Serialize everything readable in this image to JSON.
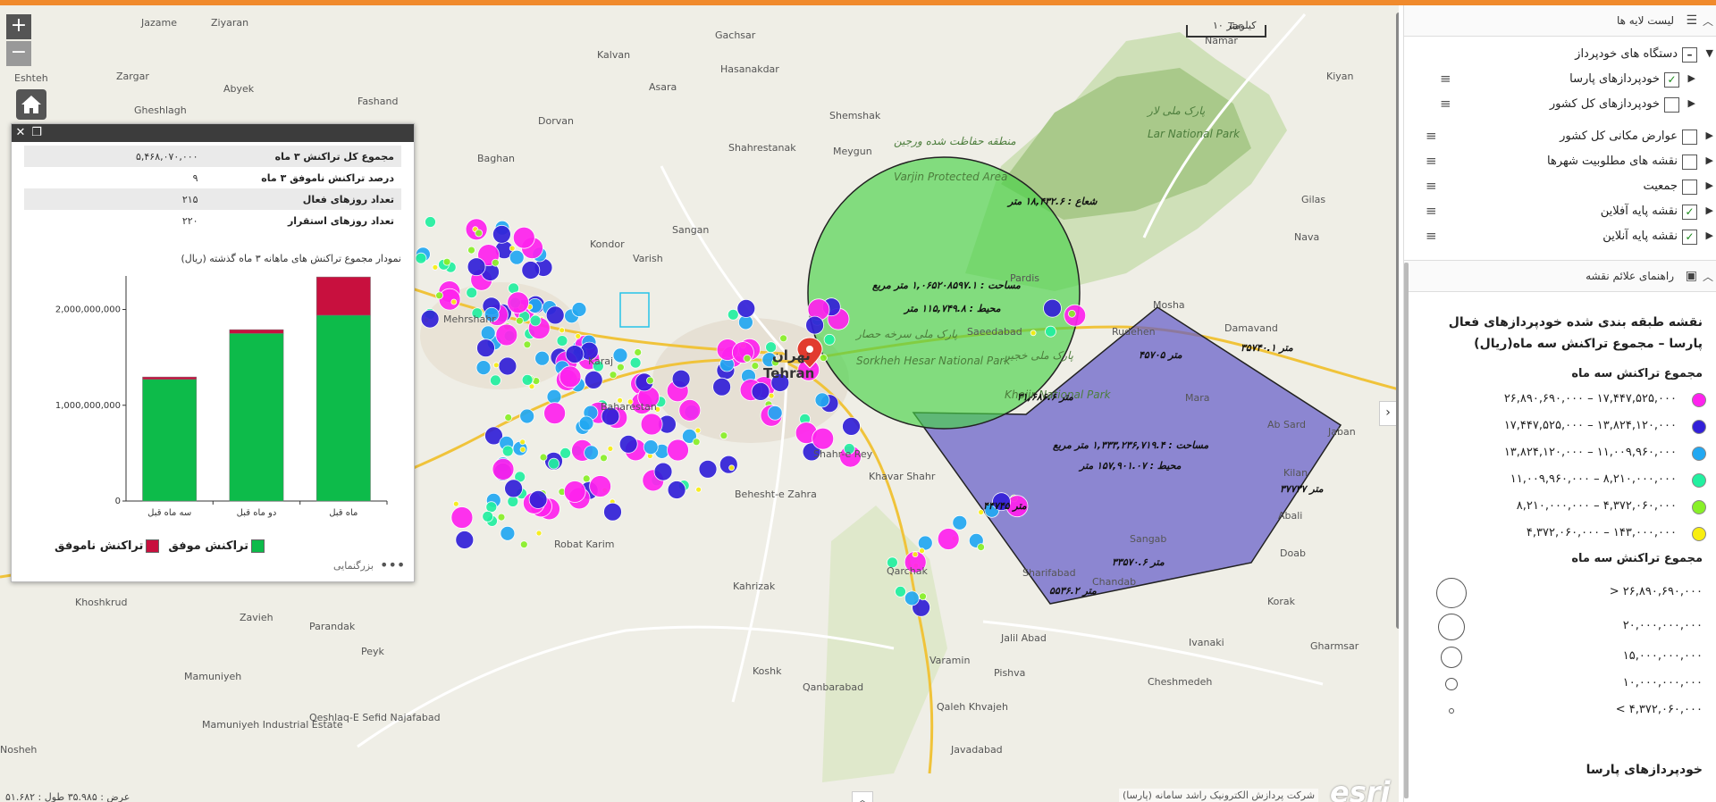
{
  "map": {
    "zoom_in": "+",
    "zoom_out": "−",
    "home_icon": "home-icon",
    "scale_label": "۱۰ کیلومتر",
    "coordinates": "عرض : ۳۵.۹۸۵   طول : ۵۱.۶۸۲",
    "attribution": "شرکت پردازش الکترونیک راشد سامانه (پارسا)",
    "esri": "esri",
    "places": [
      {
        "t": "Jazame",
        "x": 158,
        "y": 14
      },
      {
        "t": "Ziyaran",
        "x": 236,
        "y": 14
      },
      {
        "t": "Kalvan",
        "x": 668,
        "y": 50
      },
      {
        "t": "Gachsar",
        "x": 800,
        "y": 28
      },
      {
        "t": "Asara",
        "x": 726,
        "y": 86
      },
      {
        "t": "Hasanakdar",
        "x": 806,
        "y": 66
      },
      {
        "t": "Shemshak",
        "x": 928,
        "y": 118
      },
      {
        "t": "Meygun",
        "x": 932,
        "y": 158
      },
      {
        "t": "Shahrestanak",
        "x": 815,
        "y": 154
      },
      {
        "t": "Dorvan",
        "x": 602,
        "y": 124
      },
      {
        "t": "Baghan",
        "x": 534,
        "y": 166
      },
      {
        "t": "Eshteh",
        "x": 16,
        "y": 76
      },
      {
        "t": "Abyek",
        "x": 250,
        "y": 88
      },
      {
        "t": "Zargar",
        "x": 130,
        "y": 74
      },
      {
        "t": "Fashand",
        "x": 400,
        "y": 102
      },
      {
        "t": "Gheshlagh",
        "x": 150,
        "y": 112
      },
      {
        "t": "Kondor",
        "x": 660,
        "y": 262
      },
      {
        "t": "Varish",
        "x": 708,
        "y": 278
      },
      {
        "t": "Sangan",
        "x": 752,
        "y": 246
      },
      {
        "t": "Mehrshahr",
        "x": 496,
        "y": 346
      },
      {
        "t": "Karaj",
        "x": 658,
        "y": 393
      },
      {
        "t": "Baharestan",
        "x": 672,
        "y": 444
      },
      {
        "t": "Robat Karim",
        "x": 620,
        "y": 598
      },
      {
        "t": "Khoshkrud",
        "x": 84,
        "y": 663
      },
      {
        "t": "Zavieh",
        "x": 268,
        "y": 680
      },
      {
        "t": "Parandak",
        "x": 346,
        "y": 690
      },
      {
        "t": "Peyk",
        "x": 404,
        "y": 718
      },
      {
        "t": "Mamuniyeh",
        "x": 206,
        "y": 746
      },
      {
        "t": "Mamuniyeh Industrial Estate",
        "x": 226,
        "y": 800
      },
      {
        "t": "Qeshlaq-E Sefid Najafabad",
        "x": 346,
        "y": 792
      },
      {
        "t": "Nosheh",
        "x": 0,
        "y": 828
      },
      {
        "t": "Kahrizak",
        "x": 820,
        "y": 645
      },
      {
        "t": "Qanbarabad",
        "x": 898,
        "y": 758
      },
      {
        "t": "Koshk",
        "x": 842,
        "y": 740
      },
      {
        "t": "Varamin",
        "x": 1040,
        "y": 728
      },
      {
        "t": "Qaleh Khvajeh",
        "x": 1048,
        "y": 780
      },
      {
        "t": "Pishva",
        "x": 1112,
        "y": 742
      },
      {
        "t": "Javadabad",
        "x": 1064,
        "y": 828
      },
      {
        "t": "Jalil Abad",
        "x": 1120,
        "y": 703
      },
      {
        "t": "Qarchak",
        "x": 992,
        "y": 628
      },
      {
        "t": "Khavar Shahr",
        "x": 972,
        "y": 522
      },
      {
        "t": "Sharifabad",
        "x": 1144,
        "y": 630
      },
      {
        "t": "Chandab",
        "x": 1222,
        "y": 640
      },
      {
        "t": "Sangab",
        "x": 1264,
        "y": 592
      },
      {
        "t": "Korak",
        "x": 1418,
        "y": 662
      },
      {
        "t": "Doab",
        "x": 1432,
        "y": 608
      },
      {
        "t": "Abali",
        "x": 1430,
        "y": 566
      },
      {
        "t": "Kilan",
        "x": 1436,
        "y": 518
      },
      {
        "t": "Ab Sard",
        "x": 1418,
        "y": 464
      },
      {
        "t": "Jaban",
        "x": 1486,
        "y": 472
      },
      {
        "t": "Gharmsar",
        "x": 1466,
        "y": 712
      },
      {
        "t": "Cheshmedeh",
        "x": 1284,
        "y": 752
      },
      {
        "t": "Ivanaki",
        "x": 1330,
        "y": 708
      },
      {
        "t": "Mara",
        "x": 1326,
        "y": 434
      },
      {
        "t": "Damavand",
        "x": 1370,
        "y": 356
      },
      {
        "t": "Rudehen",
        "x": 1244,
        "y": 360
      },
      {
        "t": "Mosha",
        "x": 1290,
        "y": 330
      },
      {
        "t": "Saeedabad",
        "x": 1082,
        "y": 360
      },
      {
        "t": "Nava",
        "x": 1448,
        "y": 254
      },
      {
        "t": "Gilas",
        "x": 1456,
        "y": 212
      },
      {
        "t": "Kiyan",
        "x": 1484,
        "y": 74
      },
      {
        "t": "Tar",
        "x": 1374,
        "y": 18
      },
      {
        "t": "Namar",
        "x": 1348,
        "y": 34
      },
      {
        "t": "Shahr-e Rey",
        "x": 910,
        "y": 497
      },
      {
        "t": "Behesht-e Zahra",
        "x": 822,
        "y": 542
      },
      {
        "t": "Pardis",
        "x": 1130,
        "y": 300
      }
    ],
    "cities": [
      {
        "t": "Tehran",
        "x": 854,
        "y": 404
      },
      {
        "t": "تهران",
        "x": 864,
        "y": 384
      }
    ],
    "green_labels": [
      {
        "t": "منطقه حفاظت شده ورجین",
        "x": 1000,
        "y": 146
      },
      {
        "t": "Varjin Protected Area",
        "x": 1000,
        "y": 186
      },
      {
        "t": "پارک ملی لار",
        "x": 1284,
        "y": 112
      },
      {
        "t": "Lar National Park",
        "x": 1284,
        "y": 138
      },
      {
        "t": "پارک ملی سرخه حصار",
        "x": 958,
        "y": 362
      },
      {
        "t": "Sorkheh Hesar National Park",
        "x": 958,
        "y": 392
      },
      {
        "t": "پارک ملی خجیر",
        "x": 1124,
        "y": 386
      },
      {
        "t": "Khojir National Park",
        "x": 1124,
        "y": 430
      }
    ],
    "measurements": [
      {
        "t": "شعاع : ۱۸,۴۳۲.۶ متر",
        "x": 1128,
        "y": 214
      },
      {
        "t": "مساحت : ۱,۰۶۵۲۰۸۵۹۷.۱ متر مربع",
        "x": 976,
        "y": 308
      },
      {
        "t": "محیط : ۱۱۵,۷۴۹.۸ متر",
        "x": 1012,
        "y": 334
      },
      {
        "t": "۳۱,۶۸۶.۶ متر",
        "x": 1138,
        "y": 433
      },
      {
        "t": "مساحت : ۱,۳۳۳,۲۳۶,۷۱۹.۴ متر مربع",
        "x": 1178,
        "y": 487
      },
      {
        "t": "محیط : ۱۵۷,۹۰۱.۰۷ متر",
        "x": 1208,
        "y": 510
      },
      {
        "t": "۳۳۵۷۰.۶ متر",
        "x": 1244,
        "y": 618
      },
      {
        "t": "۵۵۳۶.۲ متر",
        "x": 1174,
        "y": 650
      },
      {
        "t": "۳۵۷۴۰.۱ متر",
        "x": 1388,
        "y": 378
      },
      {
        "t": "۴۵۷۰۵ متر",
        "x": 1274,
        "y": 386
      },
      {
        "t": "۳۷۷۳۷ متر",
        "x": 1432,
        "y": 536
      },
      {
        "t": "۴۴۷۴۵ متر",
        "x": 1100,
        "y": 555
      }
    ]
  },
  "popup": {
    "close_icon": "close-icon",
    "maximize_icon": "maximize-icon",
    "rows": [
      {
        "k": "مجموع کل تراکنش ۳ ماه",
        "v": "۵,۴۶۸,۰۷۰,۰۰۰"
      },
      {
        "k": "درصد تراکنش ناموفق ۳ ماه",
        "v": "۹"
      },
      {
        "k": "تعداد روزهای فعال",
        "v": "۲۱۵"
      },
      {
        "k": "تعداد روزهای استقرار",
        "v": "۲۲۰"
      }
    ],
    "chart_title": "نمودار مجموع تراکنش های ماهانه ۳ ماه گذشته (ریال)",
    "footer_link": "بزرگنمایی",
    "more": "•••"
  },
  "chart_data": {
    "type": "bar",
    "stacked": true,
    "categories": [
      "سه ماه قبل",
      "دو ماه قبل",
      "ماه قبل"
    ],
    "series": [
      {
        "name": "تراکنش موفق",
        "color": "#0dbb4a",
        "values": [
          1270000000,
          1750000000,
          1940000000
        ]
      },
      {
        "name": "تراکنش ناموفق",
        "color": "#c8103e",
        "values": [
          25000000,
          40000000,
          400000000
        ]
      }
    ],
    "ylim": [
      0,
      2350000000
    ],
    "yticks": [
      0,
      1000000000,
      2000000000
    ],
    "ytick_labels": [
      "0",
      "1,000,000,000",
      "2,000,000,000"
    ],
    "legend_position": "bottom"
  },
  "panel": {
    "layers_header": "لیست لایه ها",
    "layers_icon": "list-icon",
    "layers": [
      {
        "label": "دستگاه های خودپرداز",
        "checked": "partial",
        "level": 0,
        "expanded": true
      },
      {
        "label": "خودپردازهای پارسا",
        "checked": "yes",
        "level": 1,
        "expanded": false
      },
      {
        "label": "خودپردازهای کل کشور",
        "checked": "no",
        "level": 1,
        "expanded": false
      },
      {
        "label": "عوارض مکانی کل کشور",
        "checked": "no",
        "level": 0,
        "expanded": false
      },
      {
        "label": "نقشه های مطلوبیت شهرها",
        "checked": "no",
        "level": 0,
        "expanded": false
      },
      {
        "label": "جمعیت",
        "checked": "no",
        "level": 0,
        "expanded": false
      },
      {
        "label": "نقشه پایه آفلاین",
        "checked": "yes",
        "level": 0,
        "expanded": false
      },
      {
        "label": "نقشه پایه آنلاین",
        "checked": "yes",
        "level": 0,
        "expanded": false
      }
    ],
    "legend_header": "راهنمای علائم نقشه",
    "legend_icon": "image-icon",
    "legend_title": "نقشه طبقه بندی شده خودپردازهای فعال پارسا – مجموع تراکنش سه ماه(ریال)",
    "legend_sub1": "مجموع تراکنش سه ماه",
    "classes": [
      {
        "range": "۲۶,۸۹۰,۶۹۰,۰۰۰ – ۱۷,۴۴۷,۵۲۵,۰۰۰",
        "color": "#ff22ee"
      },
      {
        "range": "۱۷,۴۴۷,۵۲۵,۰۰۰ – ۱۳,۸۲۴,۱۲۰,۰۰۰",
        "color": "#3220d8"
      },
      {
        "range": "۱۳,۸۲۴,۱۲۰,۰۰۰ – ۱۱,۰۰۹,۹۶۰,۰۰۰",
        "color": "#22a8f2"
      },
      {
        "range": "۱۱,۰۰۹,۹۶۰,۰۰۰ – ۸,۲۱۰,۰۰۰,۰۰۰",
        "color": "#22f0a0"
      },
      {
        "range": "۸,۲۱۰,۰۰۰,۰۰۰ – ۴,۳۷۲,۰۶۰,۰۰۰",
        "color": "#88f028"
      },
      {
        "range": "۴,۳۷۲,۰۶۰,۰۰۰ – ۱۴۳,۰۰۰,۰۰۰",
        "color": "#f8ee10"
      }
    ],
    "legend_sub2": "مجموع تراکنش سه ماه",
    "sizes": [
      {
        "label": "> ۲۶,۸۹۰,۶۹۰,۰۰۰",
        "r": 16
      },
      {
        "label": "۲۰,۰۰۰,۰۰۰,۰۰۰",
        "r": 14
      },
      {
        "label": "۱۵,۰۰۰,۰۰۰,۰۰۰",
        "r": 11
      },
      {
        "label": "۱۰,۰۰۰,۰۰۰,۰۰۰",
        "r": 6
      },
      {
        "label": "< ۴,۳۷۲,۰۶۰,۰۰۰",
        "r": 2
      }
    ],
    "legend_last": "خودپردازهای پارسا"
  }
}
